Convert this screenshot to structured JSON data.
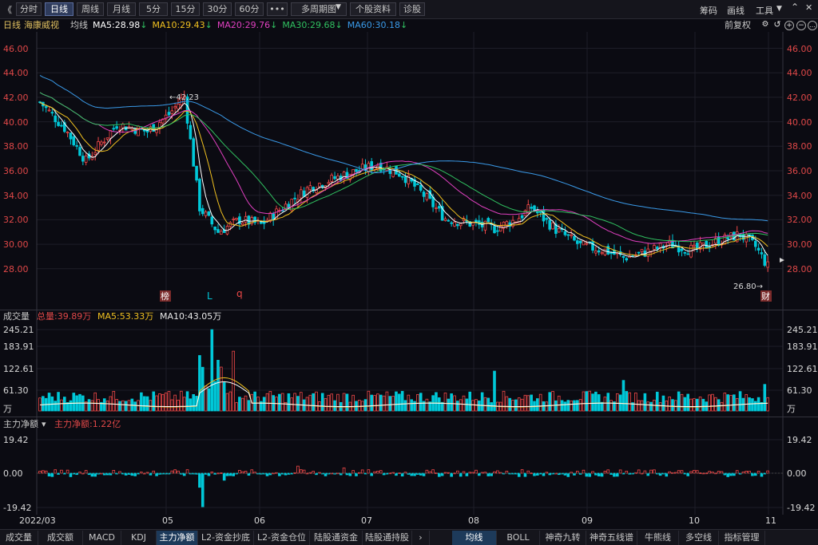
{
  "toolbar": {
    "back": "《",
    "tabs": [
      "分时",
      "日线",
      "周线",
      "月线",
      "5分",
      "15分",
      "30分",
      "60分",
      "•••",
      "多周期图",
      "个股资料",
      "诊股"
    ],
    "active": "日线",
    "right": [
      "筹码",
      "画线",
      "工具"
    ]
  },
  "header": {
    "period": "日线",
    "name": "海康威视",
    "avg_label": "均线",
    "ma": [
      {
        "t": "MA5:28.98",
        "c": "#ffffff"
      },
      {
        "t": "MA10:29.43",
        "c": "#f0c020"
      },
      {
        "t": "MA20:29.76",
        "c": "#e040c0"
      },
      {
        "t": "MA30:29.68",
        "c": "#30c060"
      },
      {
        "t": "MA60:30.18",
        "c": "#3a9ae8"
      }
    ],
    "fq": "前复权"
  },
  "price_axis": [
    "46.00",
    "44.00",
    "42.00",
    "40.00",
    "38.00",
    "36.00",
    "34.00",
    "32.00",
    "30.00",
    "28.00"
  ],
  "annotations": {
    "high": "42.23",
    "low": "26.80",
    "bang": "榜",
    "cai": "财",
    "L": "L",
    "q": "q"
  },
  "volume": {
    "title": "成交量",
    "total": "总量:39.89万",
    "ma5": "MA5:53.33万",
    "ma10": "MA10:43.05万",
    "axis": [
      "245.21",
      "183.91",
      "122.61",
      "61.30",
      "万"
    ]
  },
  "flow": {
    "title": "主力净额",
    "value": "主力净额:1.22亿",
    "axis": [
      "19.42",
      "0.00",
      "-19.42"
    ]
  },
  "xaxis": [
    "2022/03",
    "05",
    "06",
    "07",
    "08",
    "09",
    "10",
    "11"
  ],
  "bottom_tabs": [
    "成交量",
    "成交额",
    "MACD",
    "KDJ",
    "主力净额",
    "L2-资金抄底",
    "L2-资金仓位",
    "陆股通资金",
    "陆股通持股"
  ],
  "bottom_tabs2": [
    "均线",
    "BOLL",
    "神奇九转",
    "神奇五线谱",
    "牛熊线",
    "多空线",
    "指标管理"
  ],
  "chart_data": {
    "type": "candlestick",
    "title": "海康威视 日线",
    "ylim": [
      26.0,
      46.6
    ],
    "indicators": [
      "MA5",
      "MA10",
      "MA20",
      "MA30",
      "MA60"
    ],
    "ohlc_close_trend": [
      [
        0,
        41.6
      ],
      [
        8,
        39.5
      ],
      [
        15,
        36.8
      ],
      [
        25,
        39.8
      ],
      [
        35,
        39.2
      ],
      [
        42,
        40.6
      ],
      [
        47,
        42.1
      ],
      [
        52,
        33.0
      ],
      [
        58,
        31.0
      ],
      [
        65,
        32.0
      ],
      [
        72,
        31.6
      ],
      [
        80,
        33.2
      ],
      [
        88,
        34.7
      ],
      [
        95,
        35.3
      ],
      [
        102,
        35.9
      ],
      [
        110,
        36.5
      ],
      [
        118,
        35.7
      ],
      [
        125,
        34.0
      ],
      [
        132,
        32.1
      ],
      [
        140,
        31.7
      ],
      [
        148,
        31.3
      ],
      [
        155,
        32.0
      ],
      [
        160,
        33.0
      ],
      [
        168,
        31.2
      ],
      [
        176,
        29.9
      ],
      [
        184,
        29.5
      ],
      [
        190,
        28.9
      ],
      [
        198,
        29.4
      ],
      [
        205,
        30.0
      ],
      [
        213,
        29.5
      ],
      [
        220,
        30.2
      ],
      [
        228,
        30.8
      ],
      [
        233,
        29.8
      ],
      [
        237,
        28.2
      ]
    ],
    "volume_peak": "245.21万",
    "net_flow_range": [
      -19.42,
      19.42
    ]
  }
}
